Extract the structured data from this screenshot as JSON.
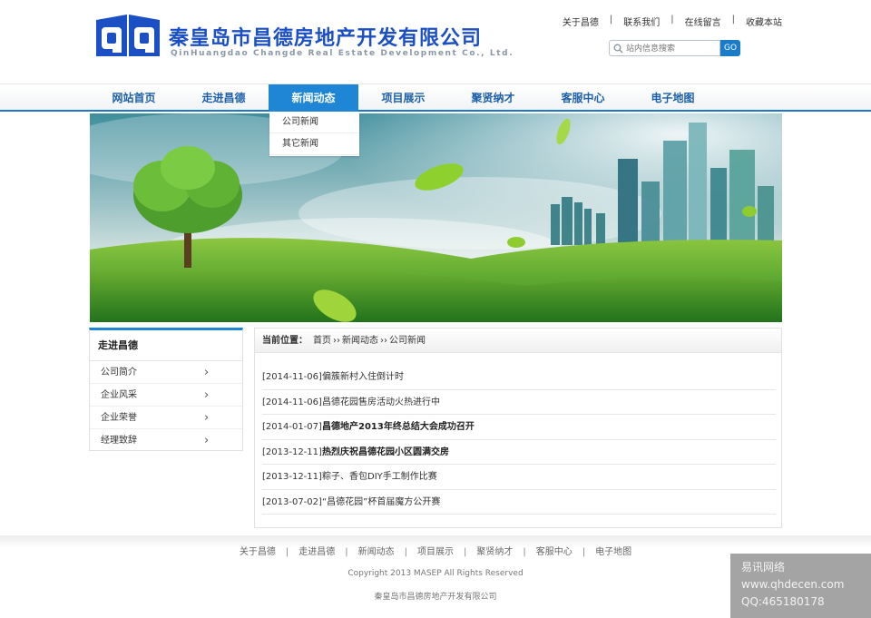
{
  "header": {
    "logo_cn": "秦皇岛市昌德房地产开发有限公司",
    "logo_en": "QinHuangdao Changde Real Estate Development Co., Ltd.",
    "top_links": [
      "关于昌德",
      "联系我们",
      "在线留言",
      "收藏本站"
    ],
    "search_placeholder": "站内信息搜索",
    "search_button": "GO"
  },
  "nav": {
    "items": [
      "网站首页",
      "走进昌德",
      "新闻动态",
      "项目展示",
      "聚贤纳才",
      "客服中心",
      "电子地图"
    ],
    "active_index": 2,
    "dropdown": [
      "公司新闻",
      "其它新闻"
    ]
  },
  "sidebar": {
    "title": "走进昌德",
    "items": [
      "公司简介",
      "企业风采",
      "企业荣誉",
      "经理致辞"
    ]
  },
  "main": {
    "breadcrumb_label": "当前位置：",
    "breadcrumb": [
      "首页",
      "新闻动态",
      "公司新闻"
    ],
    "breadcrumb_sep": "››",
    "news": [
      {
        "date": "[2014-11-06]",
        "title": "偏簇新村入住倒计时",
        "bold": false
      },
      {
        "date": "[2014-11-06]",
        "title": "昌德花园售房活动火热进行中",
        "bold": false
      },
      {
        "date": "[2014-01-07]",
        "title": "昌德地产2013年终总结大会成功召开",
        "bold": true
      },
      {
        "date": "[2013-12-11]",
        "title": "热烈庆祝昌德花园小区圆满交房",
        "bold": true
      },
      {
        "date": "[2013-12-11]",
        "title": "粽子、香包DIY手工制作比赛",
        "bold": false
      },
      {
        "date": "[2013-07-02]",
        "title": "“昌德花园”杯首届魔方公开赛",
        "bold": false
      }
    ]
  },
  "footer": {
    "links": [
      "关于昌德",
      "走进昌德",
      "新闻动态",
      "项目展示",
      "聚贤纳才",
      "客服中心",
      "电子地图"
    ],
    "copyright": "Copyright 2013 MASEP All Rights Reserved",
    "company": "秦皇岛市昌德房地产开发有限公司"
  },
  "watermark": {
    "line1": "易讯网络",
    "line2": "www.qhdecen.com",
    "line3": "QQ:465180178"
  },
  "colors": {
    "brand_blue": "#1b4fc4",
    "nav_active": "#1f86d6",
    "nav_text": "#1d5fa8"
  }
}
